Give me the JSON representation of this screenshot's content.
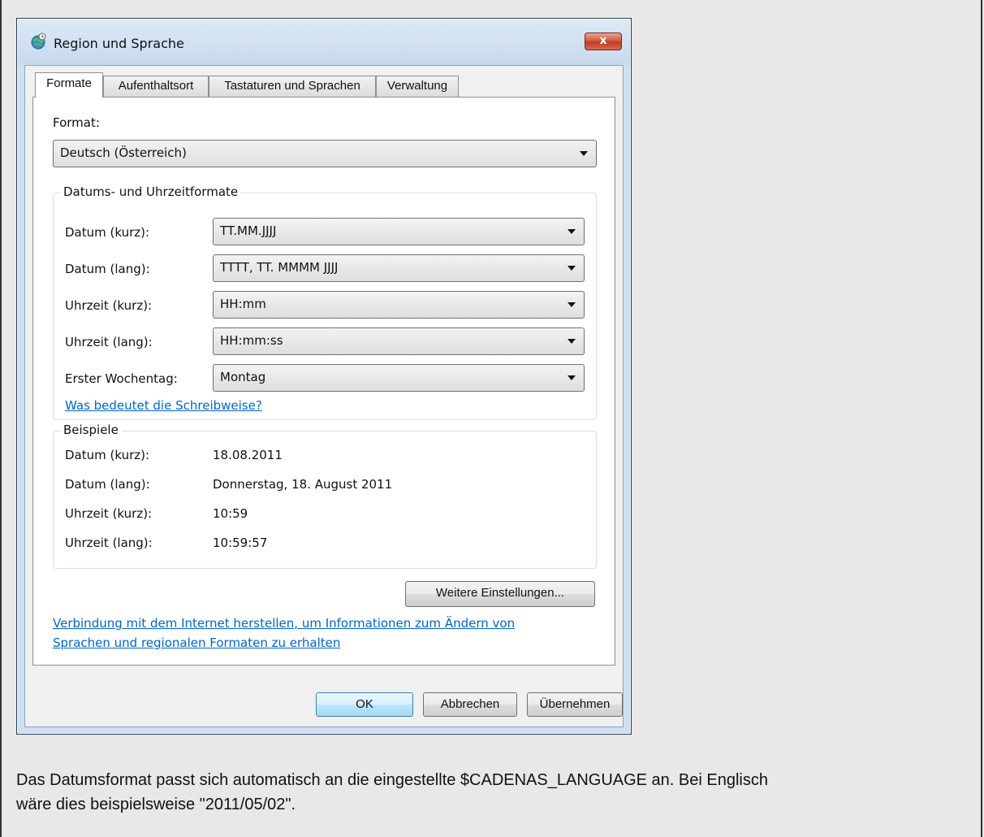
{
  "dialog": {
    "title": "Region und Sprache",
    "close_label": "x",
    "tabs": [
      {
        "label": "Formate",
        "active": true
      },
      {
        "label": "Aufenthaltsort",
        "active": false
      },
      {
        "label": "Tastaturen und Sprachen",
        "active": false
      },
      {
        "label": "Verwaltung",
        "active": false
      }
    ],
    "format_label": "Format:",
    "format_value": "Deutsch (Österreich)",
    "datetime_group_title": "Datums- und Uhrzeitformate",
    "datetime_rows": [
      {
        "label": "Datum (kurz):",
        "value": "TT.MM.JJJJ"
      },
      {
        "label": "Datum (lang):",
        "value": "TTTT, TT. MMMM JJJJ"
      },
      {
        "label": "Uhrzeit (kurz):",
        "value": "HH:mm"
      },
      {
        "label": "Uhrzeit (lang):",
        "value": "HH:mm:ss"
      },
      {
        "label": "Erster Wochentag:",
        "value": "Montag"
      }
    ],
    "notation_link": "Was bedeutet die Schreibweise?",
    "examples_group_title": "Beispiele",
    "examples": [
      {
        "label": "Datum (kurz):",
        "value": "18.08.2011"
      },
      {
        "label": "Datum (lang):",
        "value": "Donnerstag, 18. August 2011"
      },
      {
        "label": "Uhrzeit (kurz):",
        "value": "10:59"
      },
      {
        "label": "Uhrzeit (lang):",
        "value": "10:59:57"
      }
    ],
    "more_settings_button": "Weitere Einstellungen...",
    "internet_link_line1": "Verbindung mit dem Internet herstellen, um Informationen zum Ändern von",
    "internet_link_line2": "Sprachen und regionalen Formaten zu erhalten",
    "ok_button": "OK",
    "cancel_button": "Abbrechen",
    "apply_button": "Übernehmen"
  },
  "caption": {
    "line1": "Das Datumsformat passt sich automatisch an die eingestellte $CADENAS_LANGUAGE an. Bei Englisch",
    "line2": "wäre dies beispielsweise \"2011/05/02\"."
  },
  "colors": {
    "link": "#0066cc",
    "close_button": "#c23b21",
    "default_button_border": "#3c7fb1"
  },
  "icons": {
    "app": "globe-clock-icon",
    "close": "close-icon",
    "dropdown": "chevron-down-icon"
  }
}
